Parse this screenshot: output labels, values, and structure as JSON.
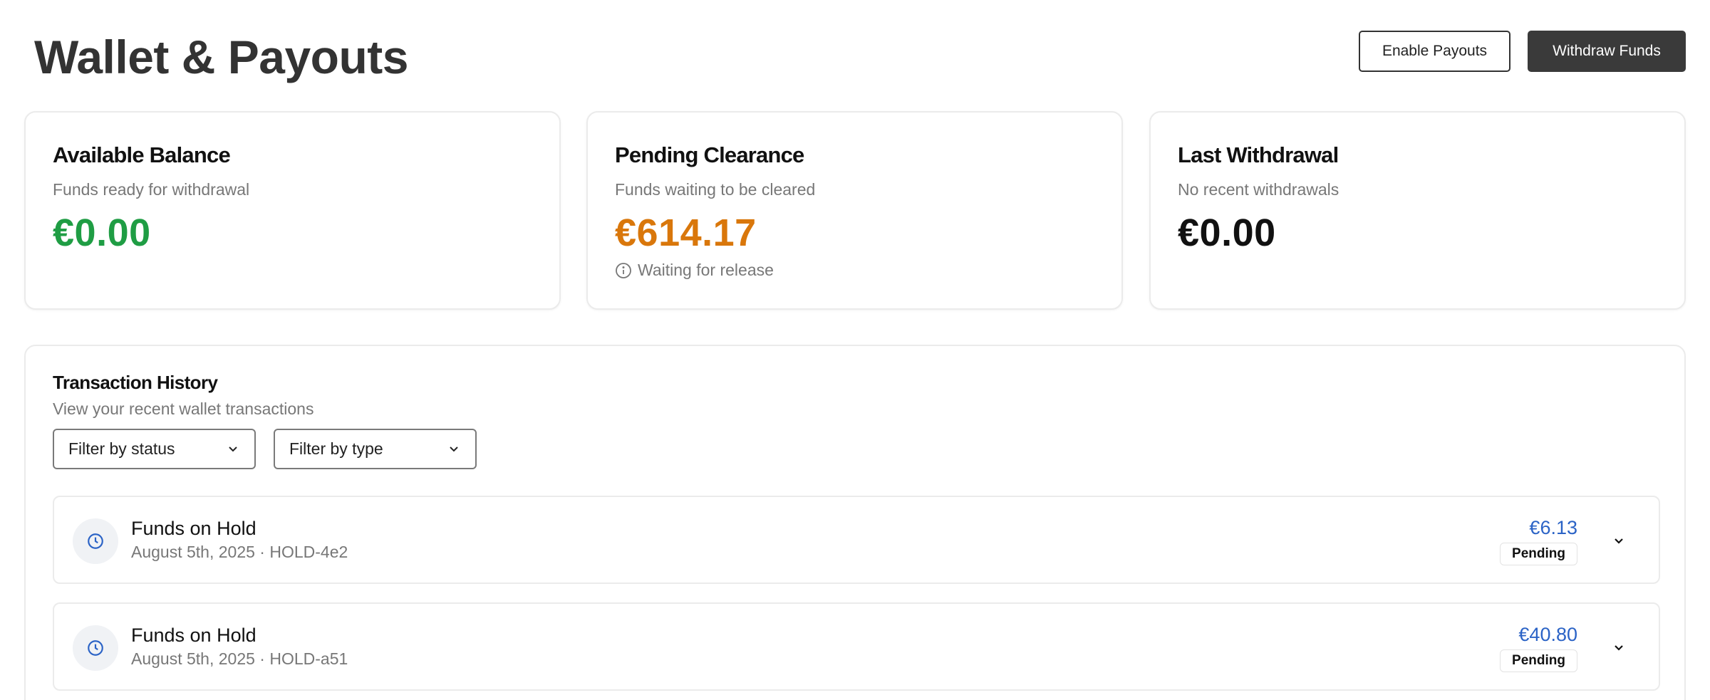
{
  "header": {
    "title": "Wallet & Payouts",
    "enable_payouts_label": "Enable Payouts",
    "withdraw_funds_label": "Withdraw Funds"
  },
  "cards": {
    "available": {
      "title": "Available Balance",
      "subtitle": "Funds ready for withdrawal",
      "value": "€0.00",
      "value_color": "#1f9d44"
    },
    "pending": {
      "title": "Pending Clearance",
      "subtitle": "Funds waiting to be cleared",
      "value": "€614.17",
      "value_color": "#d9770b",
      "note": "Waiting for release",
      "note_icon": "info-icon"
    },
    "last_withdrawal": {
      "title": "Last Withdrawal",
      "subtitle": "No recent withdrawals",
      "value": "€0.00"
    }
  },
  "transactions": {
    "title": "Transaction History",
    "subtitle": "View your recent wallet transactions",
    "filters": {
      "status_label": "Filter by status",
      "type_label": "Filter by type"
    },
    "items": [
      {
        "icon": "clock-icon",
        "title": "Funds on Hold",
        "meta": "August 5th, 2025 · HOLD-4e2",
        "amount": "€6.13",
        "status": "Pending"
      },
      {
        "icon": "clock-icon",
        "title": "Funds on Hold",
        "meta": "August 5th, 2025 · HOLD-a51",
        "amount": "€40.80",
        "status": "Pending"
      }
    ]
  },
  "colors": {
    "accent_blue": "#2b63c6",
    "dark_button": "#3a3a3a"
  }
}
